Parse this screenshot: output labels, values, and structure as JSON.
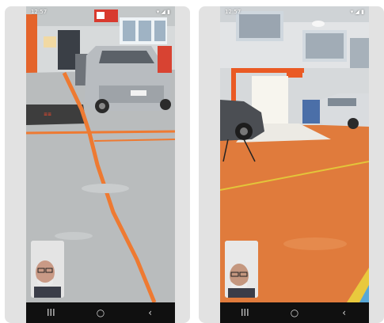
{
  "status_left": {
    "time": "12:57",
    "icons": "⚙ ✉"
  },
  "status_right": {
    "time": "12:57",
    "icons": "⚙ ✉"
  },
  "status_icons_right": "▾ ◢ ▮",
  "navbar": {
    "recents": "III",
    "home": "○",
    "back": "‹"
  },
  "colors": {
    "floor_left": "#b9bcbd",
    "floor_right": "#e07b3c",
    "accent_orange": "#ee7a32",
    "navbar": "#101010"
  },
  "icons": [
    "recents-icon",
    "home-icon",
    "back-icon",
    "wifi-icon",
    "signal-icon",
    "battery-icon"
  ]
}
